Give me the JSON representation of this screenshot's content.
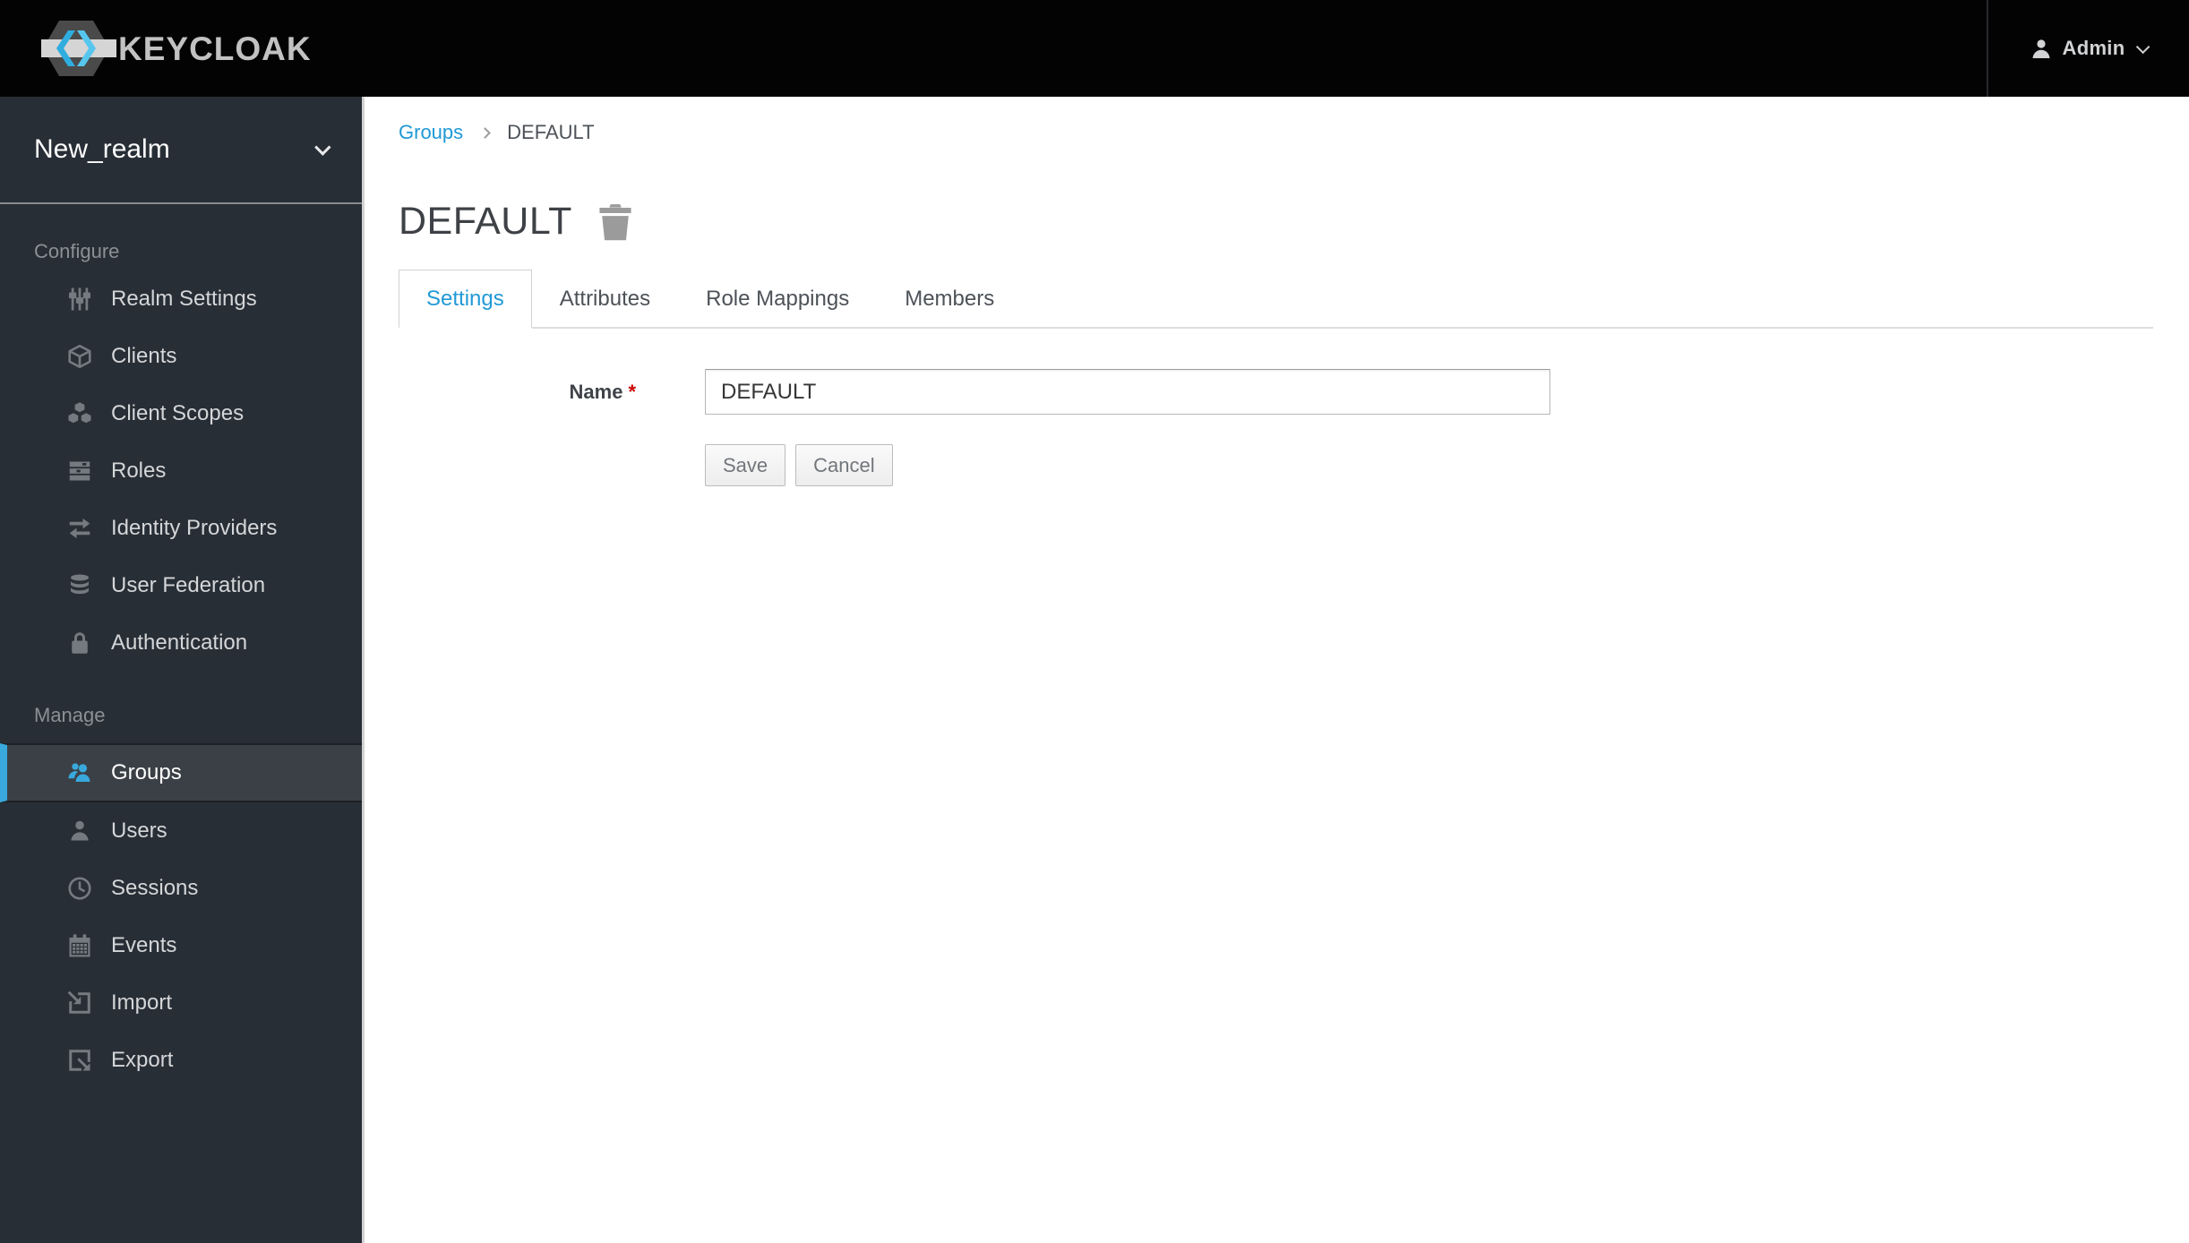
{
  "header": {
    "brand": "KEYCLOAK",
    "user_menu": {
      "label": "Admin"
    }
  },
  "sidebar": {
    "realm_selector": {
      "value": "New_realm"
    },
    "sections": [
      {
        "label": "Configure",
        "items": [
          {
            "label": "Realm Settings",
            "icon": "sliders-icon",
            "active": false
          },
          {
            "label": "Clients",
            "icon": "cube-icon",
            "active": false
          },
          {
            "label": "Client Scopes",
            "icon": "cubes-icon",
            "active": false
          },
          {
            "label": "Roles",
            "icon": "tasks-icon",
            "active": false
          },
          {
            "label": "Identity Providers",
            "icon": "exchange-arrows-icon",
            "active": false
          },
          {
            "label": "User Federation",
            "icon": "database-icon",
            "active": false
          },
          {
            "label": "Authentication",
            "icon": "lock-icon",
            "active": false
          }
        ]
      },
      {
        "label": "Manage",
        "items": [
          {
            "label": "Groups",
            "icon": "users-icon",
            "active": true
          },
          {
            "label": "Users",
            "icon": "user-icon",
            "active": false
          },
          {
            "label": "Sessions",
            "icon": "clock-icon",
            "active": false
          },
          {
            "label": "Events",
            "icon": "calendar-icon",
            "active": false
          },
          {
            "label": "Import",
            "icon": "import-icon",
            "active": false
          },
          {
            "label": "Export",
            "icon": "export-icon",
            "active": false
          }
        ]
      }
    ]
  },
  "breadcrumb": {
    "items": [
      {
        "label": "Groups",
        "link": true
      },
      {
        "label": "DEFAULT",
        "link": false
      }
    ]
  },
  "page": {
    "title": "DEFAULT",
    "tabs": [
      {
        "label": "Settings",
        "active": true
      },
      {
        "label": "Attributes",
        "active": false
      },
      {
        "label": "Role Mappings",
        "active": false
      },
      {
        "label": "Members",
        "active": false
      }
    ],
    "form": {
      "name_label": "Name",
      "required_marker": "*",
      "name_value": "DEFAULT",
      "save_label": "Save",
      "cancel_label": "Cancel"
    }
  },
  "colors": {
    "header_bg": "#030303",
    "sidebar_bg": "#282e36",
    "accent_blue": "#39a9dd",
    "link_blue": "#2199d6",
    "required_red": "#cc0000"
  }
}
